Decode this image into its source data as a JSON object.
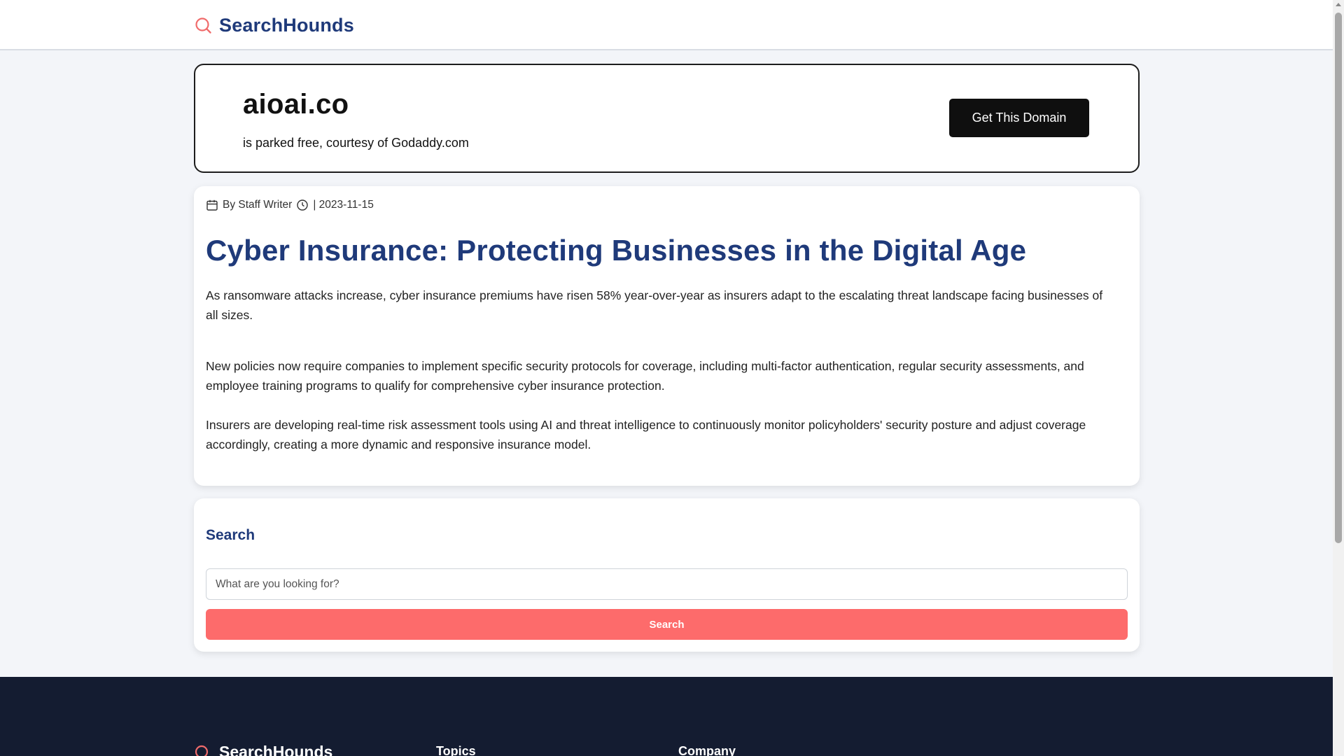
{
  "header": {
    "brand_name": "SearchHounds",
    "brand_icon": "search-icon",
    "brand_icon_color": "#f06b6b"
  },
  "domain_banner": {
    "domain": "aioai.co",
    "subtitle": "is parked free, courtesy of Godaddy.com",
    "cta_label": "Get This Domain"
  },
  "article": {
    "author": "By Staff Writer",
    "date": "| 2023-11-15",
    "author_icon": "calendar-icon",
    "date_icon": "clock-icon",
    "title": "Cyber Insurance: Protecting Businesses in the Digital Age",
    "paragraphs": [
      "As ransomware attacks increase, cyber insurance premiums have risen 58% year-over-year as insurers adapt to the escalating threat landscape facing businesses of all sizes.",
      "New policies now require companies to implement specific security protocols for coverage, including multi-factor authentication, regular security assessments, and employee training programs to qualify for comprehensive cyber insurance protection.",
      "Insurers are developing real-time risk assessment tools using AI and threat intelligence to continuously monitor policyholders' security posture and adjust coverage accordingly, creating a more dynamic and responsive insurance model."
    ]
  },
  "search": {
    "heading": "Search",
    "placeholder": "What are you looking for?",
    "button_label": "Search",
    "button_color": "#fd6b6b"
  },
  "footer": {
    "brand_name": "SearchHounds",
    "columns": [
      "Topics",
      "Company"
    ]
  },
  "colors": {
    "brand_blue": "#1f3a7a",
    "footer_bg": "#141c31",
    "accent_red": "#f06b6b"
  }
}
